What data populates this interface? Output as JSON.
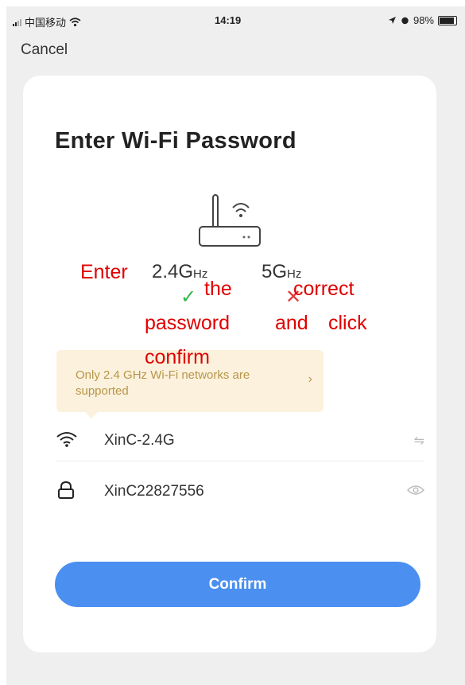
{
  "status_bar": {
    "carrier": "中国移动",
    "time": "14:19",
    "battery": "98%"
  },
  "nav": {
    "cancel_label": "Cancel"
  },
  "card": {
    "title": "Enter Wi-Fi Password",
    "bands": [
      {
        "value": "2.4G",
        "unit": "Hz",
        "supported": true
      },
      {
        "value": "5G",
        "unit": "Hz",
        "supported": false
      }
    ],
    "notice": {
      "text": "Only 2.4 GHz Wi-Fi networks are supported",
      "arrow": "›"
    },
    "ssid": {
      "value": "XinC-2.4G",
      "icon": "wifi-icon",
      "action_icon": "switch-network-icon"
    },
    "password": {
      "value": "XinC22827556",
      "icon": "lock-icon",
      "action_icon": "eye-icon"
    },
    "confirm_label": "Confirm"
  },
  "annotation": {
    "words": [
      "Enter",
      "the",
      "correct",
      "password",
      "and",
      "click",
      "confirm"
    ]
  },
  "colors": {
    "accent": "#4b8ff0",
    "notice_bg": "#fbf1dc",
    "notice_text": "#b8964a",
    "ok": "#2fb84a",
    "error": "#e23b3b",
    "annotation": "#e00000"
  }
}
